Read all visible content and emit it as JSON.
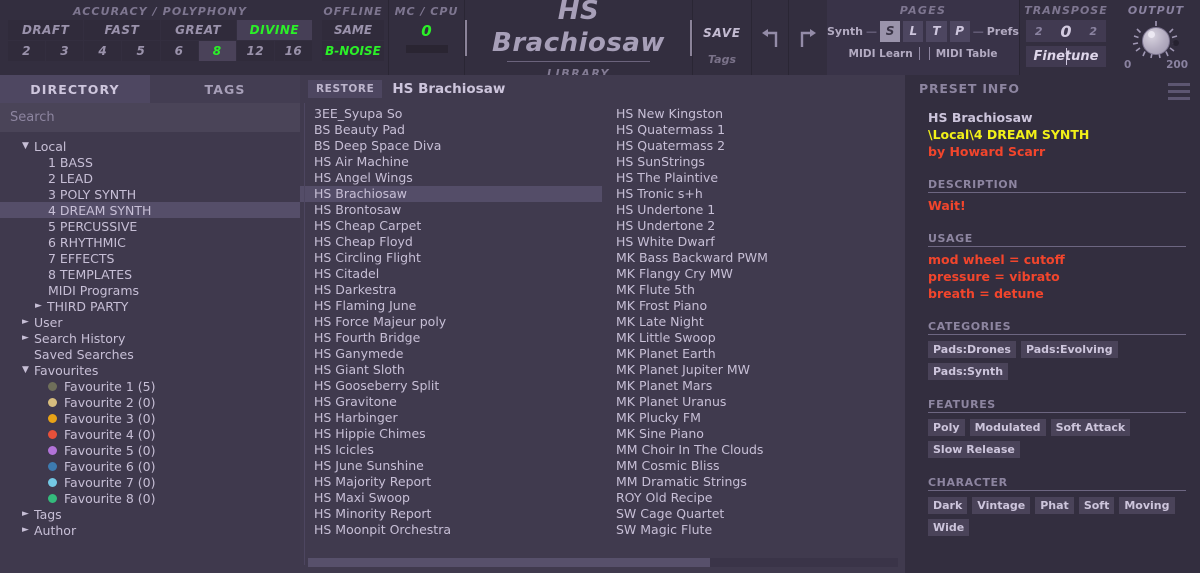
{
  "header": {
    "accuracy": {
      "label": "ACCURACY / POLYPHONY",
      "modes": [
        {
          "label": "DRAFT",
          "selected": false
        },
        {
          "label": "FAST",
          "selected": false
        },
        {
          "label": "GREAT",
          "selected": false
        },
        {
          "label": "DIVINE",
          "selected": true
        }
      ],
      "voices": [
        {
          "label": "2",
          "selected": false
        },
        {
          "label": "3",
          "selected": false
        },
        {
          "label": "4",
          "selected": false
        },
        {
          "label": "5",
          "selected": false
        },
        {
          "label": "6",
          "selected": false
        },
        {
          "label": "8",
          "selected": true
        },
        {
          "label": "12",
          "selected": false
        },
        {
          "label": "16",
          "selected": false
        }
      ]
    },
    "offline": {
      "label": "OFFLINE",
      "same_label": "SAME",
      "bnoise_label": "B-NOISE"
    },
    "mc_cpu": {
      "label": "MC / CPU",
      "value": "0"
    },
    "title": {
      "preset_name": "HS Brachiosaw",
      "subtitle": "LIBRARY"
    },
    "save": {
      "save_label": "SAVE",
      "tags_label": "Tags"
    },
    "undo_icon": "undo-arrow-icon",
    "redo_icon": "redo-arrow-icon",
    "pages": {
      "label": "PAGES",
      "left_label": "Synth",
      "right_label": "Prefs",
      "buttons": [
        {
          "label": "S",
          "active": true
        },
        {
          "label": "L",
          "active": false
        },
        {
          "label": "T",
          "active": false
        },
        {
          "label": "P",
          "active": false
        }
      ],
      "midi_learn_label": "MIDI Learn",
      "midi_table_label": "MIDI Table"
    },
    "transpose": {
      "label": "TRANSPOSE",
      "left_value": "2",
      "center_value": "0",
      "right_value": "2",
      "finetune_label": "Finetune"
    },
    "output": {
      "label": "OUTPUT",
      "min": "0",
      "max": "200"
    }
  },
  "sidebar": {
    "tabs": [
      {
        "label": "DIRECTORY",
        "active": true
      },
      {
        "label": "TAGS",
        "active": false
      }
    ],
    "search": {
      "placeholder": "Search",
      "value": ""
    },
    "tree": [
      {
        "label": "Local",
        "toggle": "down",
        "indent": 0,
        "selected": false
      },
      {
        "label": "1 BASS",
        "toggle": "none",
        "indent": 1,
        "selected": false
      },
      {
        "label": "2 LEAD",
        "toggle": "none",
        "indent": 1,
        "selected": false
      },
      {
        "label": "3 POLY SYNTH",
        "toggle": "none",
        "indent": 1,
        "selected": false
      },
      {
        "label": "4 DREAM SYNTH",
        "toggle": "none",
        "indent": 1,
        "selected": true
      },
      {
        "label": "5 PERCUSSIVE",
        "toggle": "none",
        "indent": 1,
        "selected": false
      },
      {
        "label": "6 RHYTHMIC",
        "toggle": "none",
        "indent": 1,
        "selected": false
      },
      {
        "label": "7 EFFECTS",
        "toggle": "none",
        "indent": 1,
        "selected": false
      },
      {
        "label": "8 TEMPLATES",
        "toggle": "none",
        "indent": 1,
        "selected": false
      },
      {
        "label": "MIDI Programs",
        "toggle": "none",
        "indent": 1,
        "selected": false
      },
      {
        "label": "THIRD PARTY",
        "toggle": "right",
        "indent": 1,
        "selected": false
      },
      {
        "label": "User",
        "toggle": "right",
        "indent": 0,
        "selected": false
      },
      {
        "label": "Search History",
        "toggle": "right",
        "indent": 0,
        "selected": false
      },
      {
        "label": "Saved Searches",
        "toggle": "none",
        "indent": 0,
        "selected": false
      },
      {
        "label": "Favourites",
        "toggle": "down",
        "indent": 0,
        "selected": false
      }
    ],
    "favourites": [
      {
        "label": "Favourite 1 (5)",
        "color": "#6f6f5a"
      },
      {
        "label": "Favourite 2 (0)",
        "color": "#d7bd7e"
      },
      {
        "label": "Favourite 3 (0)",
        "color": "#e8a317"
      },
      {
        "label": "Favourite 4 (0)",
        "color": "#e8503a"
      },
      {
        "label": "Favourite 5 (0)",
        "color": "#b273d9"
      },
      {
        "label": "Favourite 6 (0)",
        "color": "#3d7bb0"
      },
      {
        "label": "Favourite 7 (0)",
        "color": "#74c8e4"
      },
      {
        "label": "Favourite 8 (0)",
        "color": "#34bb7c"
      }
    ],
    "tree_tail": [
      {
        "label": "Tags",
        "toggle": "right",
        "indent": 0,
        "selected": false
      },
      {
        "label": "Author",
        "toggle": "right",
        "indent": 0,
        "selected": false
      }
    ]
  },
  "list": {
    "restore_label": "RESTORE",
    "current_preset": "HS Brachiosaw",
    "column1": [
      "3EE_Syupa So",
      "BS Beauty Pad",
      "BS Deep Space Diva",
      "HS Air Machine",
      "HS Angel Wings",
      "HS Brachiosaw",
      "HS Brontosaw",
      "HS Cheap Carpet",
      "HS Cheap Floyd",
      "HS Circling Flight",
      "HS Citadel",
      "HS Darkestra",
      "HS Flaming June",
      "HS Force Majeur poly",
      "HS Fourth Bridge",
      "HS Ganymede",
      "HS Giant Sloth",
      "HS Gooseberry Split",
      "HS Gravitone",
      "HS Harbinger",
      "HS Hippie Chimes",
      "HS Icicles",
      "HS June Sunshine",
      "HS Majority Report",
      "HS Maxi Swoop",
      "HS Minority Report",
      "HS Moonpit Orchestra"
    ],
    "column1_selected": "HS Brachiosaw",
    "column2": [
      "HS New Kingston",
      "HS Quatermass 1",
      "HS Quatermass 2",
      "HS SunStrings",
      "HS The Plaintive",
      "HS Tronic s+h",
      "HS Undertone 1",
      "HS Undertone 2",
      "HS White Dwarf",
      "MK Bass Backward PWM",
      "MK Flangy Cry MW",
      "MK Flute 5th",
      "MK Frost Piano",
      "MK Late Night",
      "MK Little Swoop",
      "MK Planet Earth",
      "MK Planet Jupiter MW",
      "MK Planet Mars",
      "MK Planet Uranus",
      "MK Plucky FM",
      "MK Sine Piano",
      "MM Choir In The Clouds",
      "MM Cosmic Bliss",
      "MM Dramatic Strings",
      "ROY Old Recipe",
      "SW Cage Quartet",
      "SW Magic Flute"
    ]
  },
  "info": {
    "panel_title": "PRESET INFO",
    "preset_name": "HS Brachiosaw",
    "preset_path": "\\Local\\4 DREAM SYNTH",
    "author": "by Howard Scarr",
    "description_title": "DESCRIPTION",
    "description_lines": [
      "Wait!"
    ],
    "usage_title": "USAGE",
    "usage_lines": [
      "mod wheel = cutoff",
      "pressure = vibrato",
      "breath = detune"
    ],
    "categories_title": "CATEGORIES",
    "categories": [
      "Pads:Drones",
      "Pads:Evolving",
      "Pads:Synth"
    ],
    "features_title": "FEATURES",
    "features": [
      "Poly",
      "Modulated",
      "Soft Attack",
      "Slow Release"
    ],
    "character_title": "CHARACTER",
    "character": [
      "Dark",
      "Vintage",
      "Phat",
      "Soft",
      "Moving",
      "Wide"
    ]
  },
  "colors": {
    "accent_green": "#2bf028",
    "accent_yellow": "#f2f118",
    "accent_red": "#f2452c",
    "background": "#3b3548",
    "panel": "#332e3f"
  }
}
